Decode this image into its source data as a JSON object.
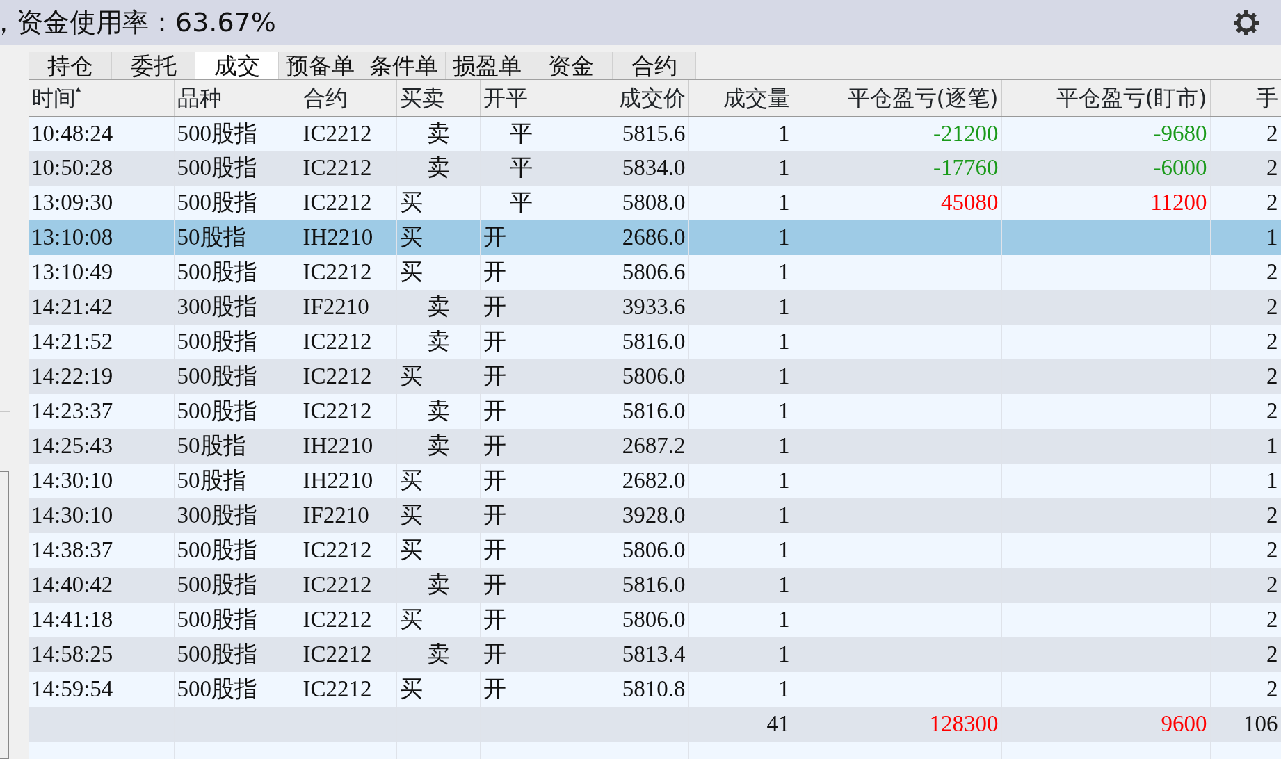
{
  "header": {
    "text": "，资金使用率：63.67%"
  },
  "tabs": [
    {
      "label": "持仓",
      "selected": false
    },
    {
      "label": "委托",
      "selected": false
    },
    {
      "label": "成交",
      "selected": true
    },
    {
      "label": "预备单",
      "selected": false
    },
    {
      "label": "条件单",
      "selected": false
    },
    {
      "label": "损盈单",
      "selected": false
    },
    {
      "label": "资金",
      "selected": false
    },
    {
      "label": "合约",
      "selected": false
    }
  ],
  "table": {
    "columns": [
      {
        "label": "时间",
        "sort_marker": "▴"
      },
      {
        "label": "品种"
      },
      {
        "label": "合约"
      },
      {
        "label": "买卖"
      },
      {
        "label": "开平"
      },
      {
        "label": "成交价"
      },
      {
        "label": "成交量"
      },
      {
        "label": "平仓盈亏(逐笔)"
      },
      {
        "label": "平仓盈亏(盯市)"
      },
      {
        "label": "手"
      }
    ],
    "rows": [
      {
        "time": "10:48:24",
        "product": "500股指",
        "contract": "IC2212",
        "side": {
          "text": "卖",
          "kind": "sell"
        },
        "offset": {
          "text": "平",
          "kind": "close"
        },
        "price": "5815.6",
        "volume": "1",
        "pnl_trade": {
          "text": "-21200",
          "color": "#1a9a1a"
        },
        "pnl_market": {
          "text": "-9680",
          "color": "#1a9a1a"
        },
        "column_10": "2",
        "selected": false
      },
      {
        "time": "10:50:28",
        "product": "500股指",
        "contract": "IC2212",
        "side": {
          "text": "卖",
          "kind": "sell"
        },
        "offset": {
          "text": "平",
          "kind": "close"
        },
        "price": "5834.0",
        "volume": "1",
        "pnl_trade": {
          "text": "-17760",
          "color": "#1a9a1a"
        },
        "pnl_market": {
          "text": "-6000",
          "color": "#1a9a1a"
        },
        "column_10": "2",
        "selected": false
      },
      {
        "time": "13:09:30",
        "product": "500股指",
        "contract": "IC2212",
        "side": {
          "text": "买",
          "kind": "buy"
        },
        "offset": {
          "text": "平",
          "kind": "close"
        },
        "price": "5808.0",
        "volume": "1",
        "pnl_trade": {
          "text": "45080",
          "color": "#ff0000"
        },
        "pnl_market": {
          "text": "11200",
          "color": "#ff0000"
        },
        "column_10": "2",
        "selected": false
      },
      {
        "time": "13:10:08",
        "product": "50股指",
        "contract": "IH2210",
        "side": {
          "text": "买",
          "kind": "buy"
        },
        "offset": {
          "text": "开",
          "kind": "open"
        },
        "price": "2686.0",
        "volume": "1",
        "column_10": "1",
        "selected": true
      },
      {
        "time": "13:10:49",
        "product": "500股指",
        "contract": "IC2212",
        "side": {
          "text": "买",
          "kind": "buy"
        },
        "offset": {
          "text": "开",
          "kind": "open"
        },
        "price": "5806.6",
        "volume": "1",
        "column_10": "2",
        "selected": false
      },
      {
        "time": "14:21:42",
        "product": "300股指",
        "contract": "IF2210",
        "side": {
          "text": "卖",
          "kind": "sell"
        },
        "offset": {
          "text": "开",
          "kind": "open"
        },
        "price": "3933.6",
        "volume": "1",
        "column_10": "2",
        "selected": false
      },
      {
        "time": "14:21:52",
        "product": "500股指",
        "contract": "IC2212",
        "side": {
          "text": "卖",
          "kind": "sell"
        },
        "offset": {
          "text": "开",
          "kind": "open"
        },
        "price": "5816.0",
        "volume": "1",
        "column_10": "2",
        "selected": false
      },
      {
        "time": "14:22:19",
        "product": "500股指",
        "contract": "IC2212",
        "side": {
          "text": "买",
          "kind": "buy"
        },
        "offset": {
          "text": "开",
          "kind": "open"
        },
        "price": "5806.0",
        "volume": "1",
        "column_10": "2",
        "selected": false
      },
      {
        "time": "14:23:37",
        "product": "500股指",
        "contract": "IC2212",
        "side": {
          "text": "卖",
          "kind": "sell"
        },
        "offset": {
          "text": "开",
          "kind": "open"
        },
        "price": "5816.0",
        "volume": "1",
        "column_10": "2",
        "selected": false
      },
      {
        "time": "14:25:43",
        "product": "50股指",
        "contract": "IH2210",
        "side": {
          "text": "卖",
          "kind": "sell"
        },
        "offset": {
          "text": "开",
          "kind": "open"
        },
        "price": "2687.2",
        "volume": "1",
        "column_10": "1",
        "selected": false
      },
      {
        "time": "14:30:10",
        "product": "50股指",
        "contract": "IH2210",
        "side": {
          "text": "买",
          "kind": "buy"
        },
        "offset": {
          "text": "开",
          "kind": "open"
        },
        "price": "2682.0",
        "volume": "1",
        "column_10": "1",
        "selected": false
      },
      {
        "time": "14:30:10",
        "product": "300股指",
        "contract": "IF2210",
        "side": {
          "text": "买",
          "kind": "buy"
        },
        "offset": {
          "text": "开",
          "kind": "open"
        },
        "price": "3928.0",
        "volume": "1",
        "column_10": "2",
        "selected": false
      },
      {
        "time": "14:38:37",
        "product": "500股指",
        "contract": "IC2212",
        "side": {
          "text": "买",
          "kind": "buy"
        },
        "offset": {
          "text": "开",
          "kind": "open"
        },
        "price": "5806.0",
        "volume": "1",
        "column_10": "2",
        "selected": false
      },
      {
        "time": "14:40:42",
        "product": "500股指",
        "contract": "IC2212",
        "side": {
          "text": "卖",
          "kind": "sell"
        },
        "offset": {
          "text": "开",
          "kind": "open"
        },
        "price": "5816.0",
        "volume": "1",
        "column_10": "2",
        "selected": false
      },
      {
        "time": "14:41:18",
        "product": "500股指",
        "contract": "IC2212",
        "side": {
          "text": "买",
          "kind": "buy"
        },
        "offset": {
          "text": "开",
          "kind": "open"
        },
        "price": "5806.0",
        "volume": "1",
        "column_10": "2",
        "selected": false
      },
      {
        "time": "14:58:25",
        "product": "500股指",
        "contract": "IC2212",
        "side": {
          "text": "卖",
          "kind": "sell"
        },
        "offset": {
          "text": "开",
          "kind": "open"
        },
        "price": "5813.4",
        "volume": "1",
        "column_10": "2",
        "selected": false
      },
      {
        "time": "14:59:54",
        "product": "500股指",
        "contract": "IC2212",
        "side": {
          "text": "买",
          "kind": "buy"
        },
        "offset": {
          "text": "开",
          "kind": "open"
        },
        "price": "5810.8",
        "volume": "1",
        "column_10": "2",
        "selected": false
      }
    ],
    "totals": {
      "volume": "41",
      "pnl_trade": {
        "text": "128300",
        "color": "#ff0000"
      },
      "pnl_market": {
        "text": "9600",
        "color": "#ff0000"
      },
      "column_10": "106"
    }
  }
}
